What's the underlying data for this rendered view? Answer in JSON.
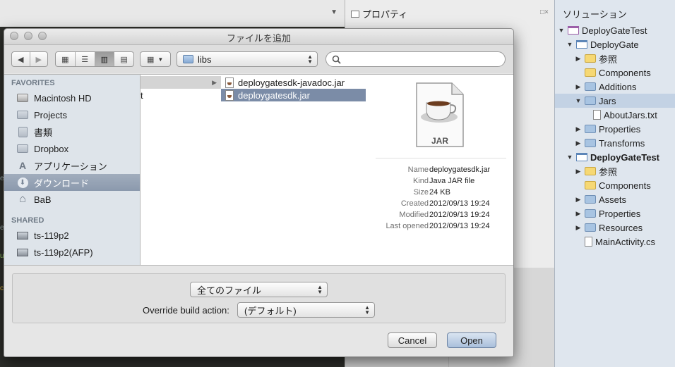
{
  "properties_panel": {
    "title": "プロパティ"
  },
  "solution_panel": {
    "title": "ソリューション",
    "tree": [
      {
        "label": "DeployGateTest",
        "indent": 0,
        "expanded": true,
        "kind": "solution",
        "bold": false
      },
      {
        "label": "DeployGate",
        "indent": 1,
        "expanded": true,
        "kind": "project",
        "bold": false
      },
      {
        "label": "参照",
        "indent": 2,
        "expanded": false,
        "kind": "folder-yellow",
        "bold": false
      },
      {
        "label": "Components",
        "indent": 2,
        "expanded": null,
        "kind": "folder-yellow",
        "bold": false
      },
      {
        "label": "Additions",
        "indent": 2,
        "expanded": false,
        "kind": "folder",
        "bold": false
      },
      {
        "label": "Jars",
        "indent": 2,
        "expanded": true,
        "kind": "folder",
        "bold": false,
        "selected": true
      },
      {
        "label": "AboutJars.txt",
        "indent": 3,
        "expanded": null,
        "kind": "file",
        "bold": false
      },
      {
        "label": "Properties",
        "indent": 2,
        "expanded": false,
        "kind": "folder",
        "bold": false
      },
      {
        "label": "Transforms",
        "indent": 2,
        "expanded": false,
        "kind": "folder",
        "bold": false
      },
      {
        "label": "DeployGateTest",
        "indent": 1,
        "expanded": true,
        "kind": "project",
        "bold": true
      },
      {
        "label": "参照",
        "indent": 2,
        "expanded": false,
        "kind": "folder-yellow",
        "bold": false
      },
      {
        "label": "Components",
        "indent": 2,
        "expanded": null,
        "kind": "folder-yellow",
        "bold": false
      },
      {
        "label": "Assets",
        "indent": 2,
        "expanded": false,
        "kind": "folder",
        "bold": false
      },
      {
        "label": "Properties",
        "indent": 2,
        "expanded": false,
        "kind": "folder",
        "bold": false
      },
      {
        "label": "Resources",
        "indent": 2,
        "expanded": false,
        "kind": "folder",
        "bold": false
      },
      {
        "label": "MainActivity.cs",
        "indent": 2,
        "expanded": null,
        "kind": "file",
        "bold": false
      }
    ]
  },
  "ide_margin": [
    "t",
    "e",
    "e",
    "u",
    "ck"
  ],
  "dialog": {
    "title": "ファイルを追加",
    "location": "libs",
    "search_placeholder": "",
    "sidebar": {
      "favorites_header": "FAVORITES",
      "favorites": [
        {
          "label": "Macintosh HD",
          "icon": "disk-icon"
        },
        {
          "label": "Projects",
          "icon": "folder-icon"
        },
        {
          "label": "書類",
          "icon": "documents-icon"
        },
        {
          "label": "Dropbox",
          "icon": "folder-icon"
        },
        {
          "label": "アプリケーション",
          "icon": "applications-icon"
        },
        {
          "label": "ダウンロード",
          "icon": "downloads-icon",
          "selected": true
        },
        {
          "label": "BaB",
          "icon": "home-icon"
        }
      ],
      "shared_header": "SHARED",
      "shared": [
        {
          "label": "ts-119p2",
          "icon": "monitor-icon"
        },
        {
          "label": "ts-119p2(AFP)",
          "icon": "monitor-icon"
        }
      ]
    },
    "column1": {
      "text": "t"
    },
    "column2": {
      "files": [
        {
          "name": "deploygatesdk-javadoc.jar",
          "selected": false
        },
        {
          "name": "deploygatesdk.jar",
          "selected": true
        }
      ]
    },
    "preview": {
      "icon_text": "JAR",
      "meta": [
        {
          "label": "Name",
          "value": "deploygatesdk.jar"
        },
        {
          "label": "Kind",
          "value": "Java JAR file"
        },
        {
          "label": "Size",
          "value": "24 KB"
        },
        {
          "label": "Created",
          "value": "2012/09/13 19:24"
        },
        {
          "label": "Modified",
          "value": "2012/09/13 19:24"
        },
        {
          "label": "Last opened",
          "value": "2012/09/13 19:24"
        }
      ]
    },
    "filter": {
      "selected": "全てのファイル"
    },
    "build_action": {
      "label": "Override build action:",
      "selected": "(デフォルト)"
    },
    "buttons": {
      "cancel": "Cancel",
      "open": "Open"
    }
  }
}
